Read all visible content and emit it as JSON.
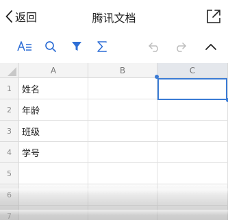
{
  "header": {
    "back_label": "返回",
    "title": "腾讯文档"
  },
  "toolbar": {
    "icons": [
      "text-format-icon",
      "search-icon",
      "filter-icon",
      "sum-icon",
      "undo-icon",
      "redo-icon",
      "collapse-icon"
    ]
  },
  "grid": {
    "columns": [
      "A",
      "B",
      "C"
    ],
    "rows": [
      "1",
      "2",
      "3",
      "4",
      "5",
      "6",
      "7"
    ],
    "cells_A": [
      "姓名",
      "年龄",
      "班级",
      "学号"
    ],
    "selected_cell": "C1"
  },
  "colors": {
    "accent": "#3a7bd5",
    "toolbar_icon": "#2f6fd6"
  }
}
